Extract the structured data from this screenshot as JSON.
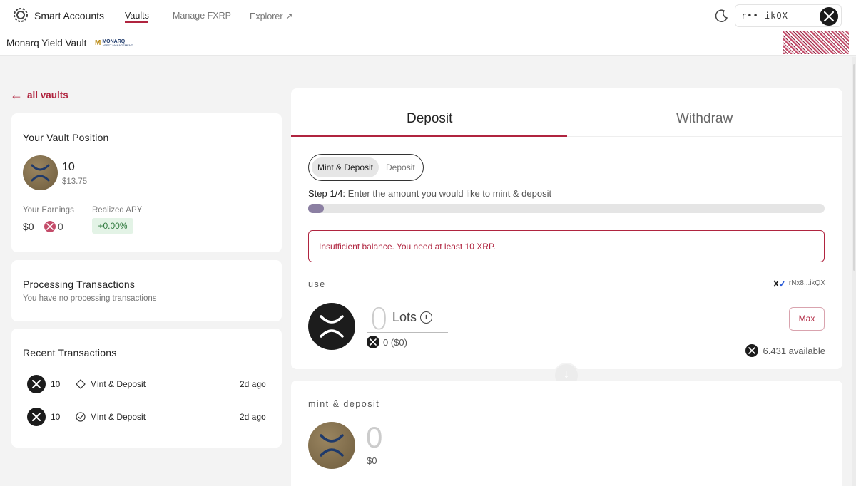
{
  "nav": {
    "brand": "Smart Accounts",
    "links": [
      "Vaults",
      "Manage FXRP",
      "Explorer ↗"
    ],
    "wallet_masked": "r•• ikQX"
  },
  "vault": {
    "name": "Monarq Yield Vault",
    "logo_m": "M",
    "logo_text": "MONARQ",
    "logo_sub": "ASSET MANAGEMENT"
  },
  "back_link": "all vaults",
  "position": {
    "title": "Your Vault Position",
    "amount": "10",
    "usd": "$13.75",
    "earnings_label": "Your Earnings",
    "earnings_usd": "$0",
    "earnings_xrp": "0",
    "apy_label": "Realized APY",
    "apy_value": "+0.00%"
  },
  "processing": {
    "title": "Processing Transactions",
    "empty": "You have no processing transactions"
  },
  "recent": {
    "title": "Recent Transactions",
    "rows": [
      {
        "amount": "10",
        "type": "Mint & Deposit",
        "time": "2d ago",
        "status_icon": "diamond-icon"
      },
      {
        "amount": "10",
        "type": "Mint & Deposit",
        "time": "2d ago",
        "status_icon": "check-circle-icon"
      }
    ]
  },
  "panel": {
    "tabs": [
      "Deposit",
      "Withdraw"
    ],
    "segments": [
      "Mint & Deposit",
      "Deposit"
    ],
    "step_prefix": "Step 1/4:",
    "step_text": "Enter the amount you would like to mint & deposit",
    "progress": 0.03,
    "error": "Insufficient balance. You need at least 10 XRP.",
    "use_label": "use",
    "address": "rNx8...ikQX",
    "amount": "0",
    "unit": "Lots",
    "sub_amount": "0 ($0)",
    "max_label": "Max",
    "available": "6.431 available",
    "mint_label": "mint & deposit",
    "mint_amount": "0",
    "mint_usd": "$0"
  },
  "colors": {
    "accent": "#b0243f",
    "progress": "#8b7fa2"
  }
}
